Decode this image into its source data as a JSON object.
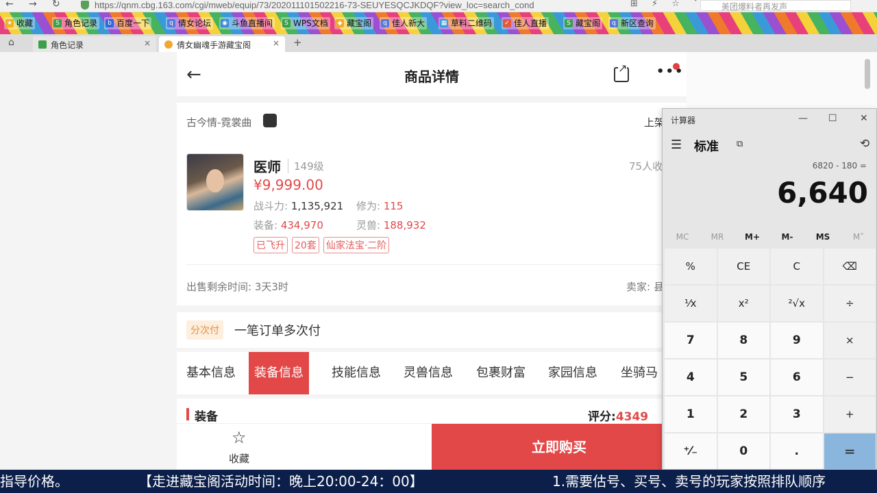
{
  "browser": {
    "url": "https://qnm.cbg.163.com/cgi/mweb/equip/73/202011101502216-73-SEUYESQCJKDQF?view_loc=search_cond",
    "search_placeholder": "美团爆料者再发声",
    "nav_back": "←",
    "nav_forward": "→",
    "nav_reload": "↻",
    "bookmarks": [
      "收藏",
      "角色记录",
      "百度一下",
      "倩女论坛",
      "斗鱼直播间",
      "WPS文档",
      "藏宝阁",
      "佳人新大",
      "草料二维码",
      "佳人直播",
      "藏宝阁",
      "新区查询"
    ],
    "tabs": [
      {
        "label": "角色记录",
        "close": "×"
      },
      {
        "label": "倩女幽魂手游藏宝阁",
        "close": "×"
      }
    ],
    "new_tab": "+"
  },
  "header": {
    "title": "商品详情",
    "back": "←",
    "more": "•••"
  },
  "item": {
    "server": "古今情-霓裳曲",
    "listed_label": "上架",
    "role": "医师",
    "level": "149级",
    "fav_count": "75人收",
    "price": "¥9,999.00",
    "power_label": "战斗力:",
    "power_value": "1,135,921",
    "cultivation_label": "修为:",
    "cultivation_value": "115",
    "equip_label": "装备:",
    "equip_value": "434,970",
    "pet_label": "灵兽:",
    "pet_value": "188,932",
    "badges": [
      "已飞升",
      "20套",
      "仙家法宝·二阶"
    ],
    "remaining": "出售剩余时间: 3天3时",
    "seller": "卖家: 县"
  },
  "payment": {
    "tag": "分次付",
    "text": "一笔订单多次付"
  },
  "nav_tabs": [
    "基本信息",
    "装备信息",
    "技能信息",
    "灵兽信息",
    "包裹财富",
    "家园信息",
    "坐骑马"
  ],
  "equip_section": {
    "label": "装备",
    "score_label": "评分:",
    "score_value": "4349"
  },
  "bottom": {
    "star": "☆",
    "fav_label": "收藏",
    "buy_label": "立即购买"
  },
  "calculator": {
    "title": "计算器",
    "min": "—",
    "max": "☐",
    "close": "✕",
    "menu": "☰",
    "mode": "标准",
    "history": "⟲",
    "expression": "6820 - 180 =",
    "result": "6,640",
    "memory": [
      "MC",
      "MR",
      "M+",
      "M-",
      "MS",
      "M˅"
    ],
    "keys": [
      "%",
      "CE",
      "C",
      "⌫",
      "¹⁄x",
      "x²",
      "²√x",
      "÷",
      "7",
      "8",
      "9",
      "×",
      "4",
      "5",
      "6",
      "−",
      "1",
      "2",
      "3",
      "+",
      "⁺⁄₋",
      "0",
      ".",
      "="
    ]
  },
  "ticker": {
    "left": "指导价格。",
    "middle": "【走进藏宝阁活动时间：晚上20:00-24：00】",
    "right": "1.需要估号、买号、卖号的玩家按照排队顺序"
  }
}
